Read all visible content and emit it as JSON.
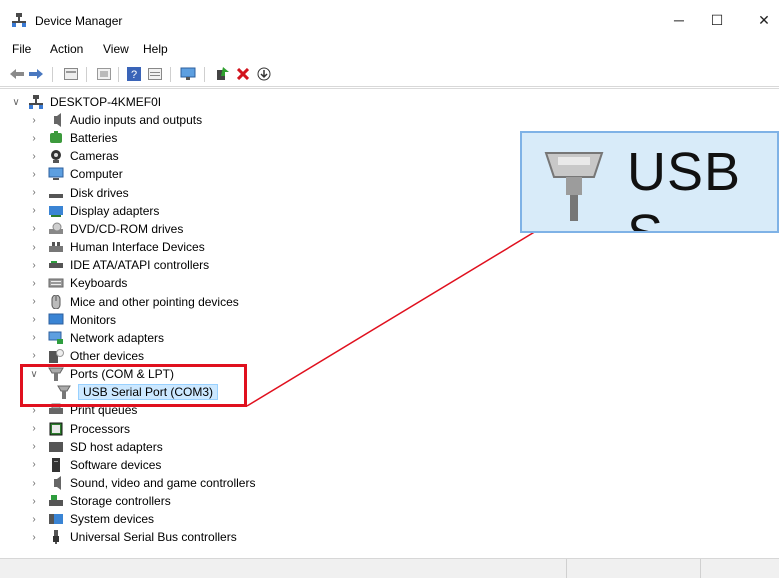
{
  "window": {
    "title": "Device Manager",
    "minimize_glyph": "─",
    "maximize_glyph": "☐",
    "close_glyph": "✕"
  },
  "menu": {
    "items": [
      "File",
      "Action",
      "View",
      "Help"
    ]
  },
  "toolbar": {
    "icons": [
      "back-icon",
      "forward-icon",
      "properties-icon",
      "view-icon",
      "help-icon",
      "details-icon",
      "monitor-icon",
      "update-driver-icon",
      "uninstall-icon",
      "scan-icon"
    ]
  },
  "tree": {
    "root": "DESKTOP-4KMEF0I",
    "categories": [
      {
        "label": "Audio inputs and outputs",
        "icon": "speaker-icon"
      },
      {
        "label": "Batteries",
        "icon": "battery-icon"
      },
      {
        "label": "Cameras",
        "icon": "camera-icon"
      },
      {
        "label": "Computer",
        "icon": "computer-icon"
      },
      {
        "label": "Disk drives",
        "icon": "disk-icon"
      },
      {
        "label": "Display adapters",
        "icon": "display-icon"
      },
      {
        "label": "DVD/CD-ROM drives",
        "icon": "dvd-icon"
      },
      {
        "label": "Human Interface Devices",
        "icon": "hid-icon"
      },
      {
        "label": "IDE ATA/ATAPI controllers",
        "icon": "ide-icon"
      },
      {
        "label": "Keyboards",
        "icon": "keyboard-icon"
      },
      {
        "label": "Mice and other pointing devices",
        "icon": "mouse-icon"
      },
      {
        "label": "Monitors",
        "icon": "monitor-icon"
      },
      {
        "label": "Network adapters",
        "icon": "network-icon"
      },
      {
        "label": "Other devices",
        "icon": "unknown-device-icon"
      },
      {
        "label": "Ports (COM & LPT)",
        "icon": "port-icon",
        "expanded": true
      },
      {
        "label": "USB Serial Port (COM3)",
        "icon": "usb-serial-icon",
        "child": true
      },
      {
        "label": "Print queues",
        "icon": "printer-icon"
      },
      {
        "label": "Processors",
        "icon": "processor-icon"
      },
      {
        "label": "SD host adapters",
        "icon": "sd-icon"
      },
      {
        "label": "Software devices",
        "icon": "software-icon"
      },
      {
        "label": "Sound, video and game controllers",
        "icon": "sound-icon"
      },
      {
        "label": "Storage controllers",
        "icon": "storage-icon"
      },
      {
        "label": "System devices",
        "icon": "system-icon"
      },
      {
        "label": "Universal Serial Bus controllers",
        "icon": "usb-icon"
      }
    ]
  },
  "callout": {
    "zoom_text": "USB S"
  },
  "colors": {
    "highlight_box": "#e0101e",
    "selection_bg": "#cce8ff",
    "callout_bg": "#d8ebf9"
  }
}
